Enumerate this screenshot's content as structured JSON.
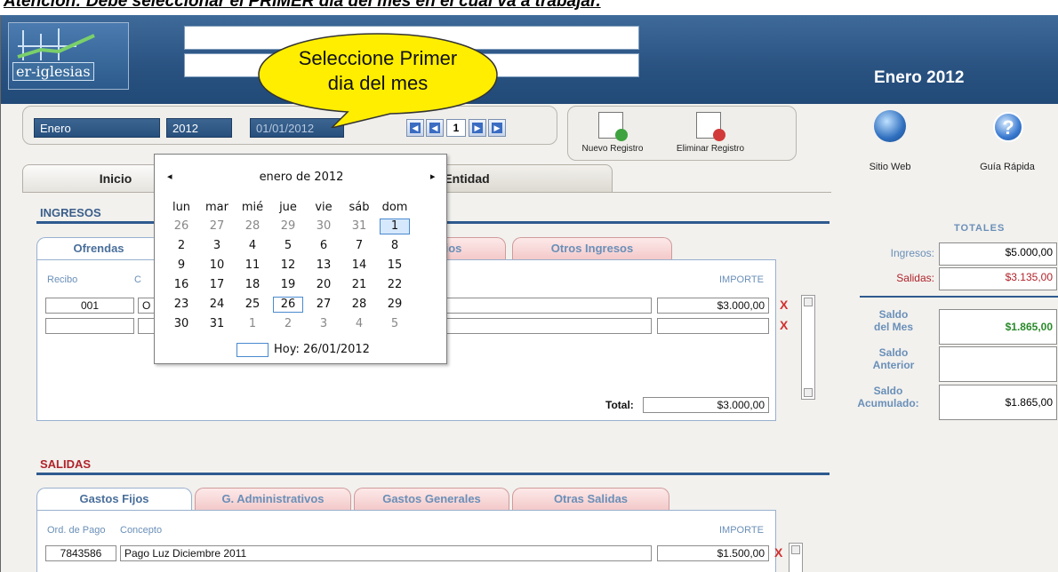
{
  "caption": "Atención: Debe seleccionar el PRIMER día del mes en el cual va a trabajar.",
  "logo_text": "er-iglesias",
  "header": {
    "month_year": "Enero 2012"
  },
  "callout": {
    "line1": "Seleccione Primer",
    "line2": "dia del mes"
  },
  "toolbar": {
    "month": "Enero",
    "year": "2012",
    "date": "01/01/2012",
    "page": "1"
  },
  "actions": {
    "new": "Nuevo Registro",
    "delete": "Eliminar Registro"
  },
  "side_buttons": {
    "web": "Sitio Web",
    "guide": "Guía Rápida"
  },
  "main_tabs": {
    "inicio": "Inicio",
    "entidad": "Entidad"
  },
  "ingresos": {
    "title": "INGRESOS",
    "tabs": {
      "ofrendas": "Ofrendas",
      "hidden": "ios",
      "otros": "Otros Ingresos"
    },
    "col_recibo": "Recibo",
    "col_concepto": "C",
    "col_importe": "IMPORTE",
    "rows": [
      {
        "recibo": "001",
        "concepto": "O",
        "importe": "$3.000,00"
      }
    ],
    "total_label": "Total:",
    "total": "$3.000,00"
  },
  "salidas": {
    "title": "SALIDAS",
    "tabs": {
      "fijos": "Gastos Fijos",
      "admin": "G. Administrativos",
      "generales": "Gastos Generales",
      "otras": "Otras Salidas"
    },
    "col_orden": "Ord. de Pago",
    "col_concepto": "Concepto",
    "col_importe": "IMPORTE",
    "rows": [
      {
        "orden": "7843586",
        "concepto": "Pago Luz Diciembre 2011",
        "importe": "$1.500,00"
      }
    ]
  },
  "totales": {
    "title": "TOTALES",
    "ingresos_label": "Ingresos:",
    "ingresos": "$5.000,00",
    "salidas_label": "Salidas:",
    "salidas": "$3.135,00",
    "saldo_mes_label1": "Saldo",
    "saldo_mes_label2": "del Mes",
    "saldo_mes": "$1.865,00",
    "saldo_ant_label1": "Saldo",
    "saldo_ant_label2": "Anterior",
    "saldo_ant": "",
    "saldo_acum_label1": "Saldo",
    "saldo_acum_label2": "Acumulado:",
    "saldo_acum": "$1.865,00"
  },
  "calendar": {
    "title": "enero de 2012",
    "prev": "◂",
    "next": "▸",
    "day_names": [
      "lun",
      "mar",
      "mié",
      "jue",
      "vie",
      "sáb",
      "dom"
    ],
    "weeks": [
      [
        "26",
        "27",
        "28",
        "29",
        "30",
        "31",
        "1"
      ],
      [
        "2",
        "3",
        "4",
        "5",
        "6",
        "7",
        "8"
      ],
      [
        "9",
        "10",
        "11",
        "12",
        "13",
        "14",
        "15"
      ],
      [
        "16",
        "17",
        "18",
        "19",
        "20",
        "21",
        "22"
      ],
      [
        "23",
        "24",
        "25",
        "26",
        "27",
        "28",
        "29"
      ],
      [
        "30",
        "31",
        "1",
        "2",
        "3",
        "4",
        "5"
      ]
    ],
    "today_label": "Hoy: 26/01/2012"
  },
  "colors": {
    "header_blue": "#295281",
    "accent_red": "#b0232a",
    "link_blue": "#6a8fb8"
  }
}
